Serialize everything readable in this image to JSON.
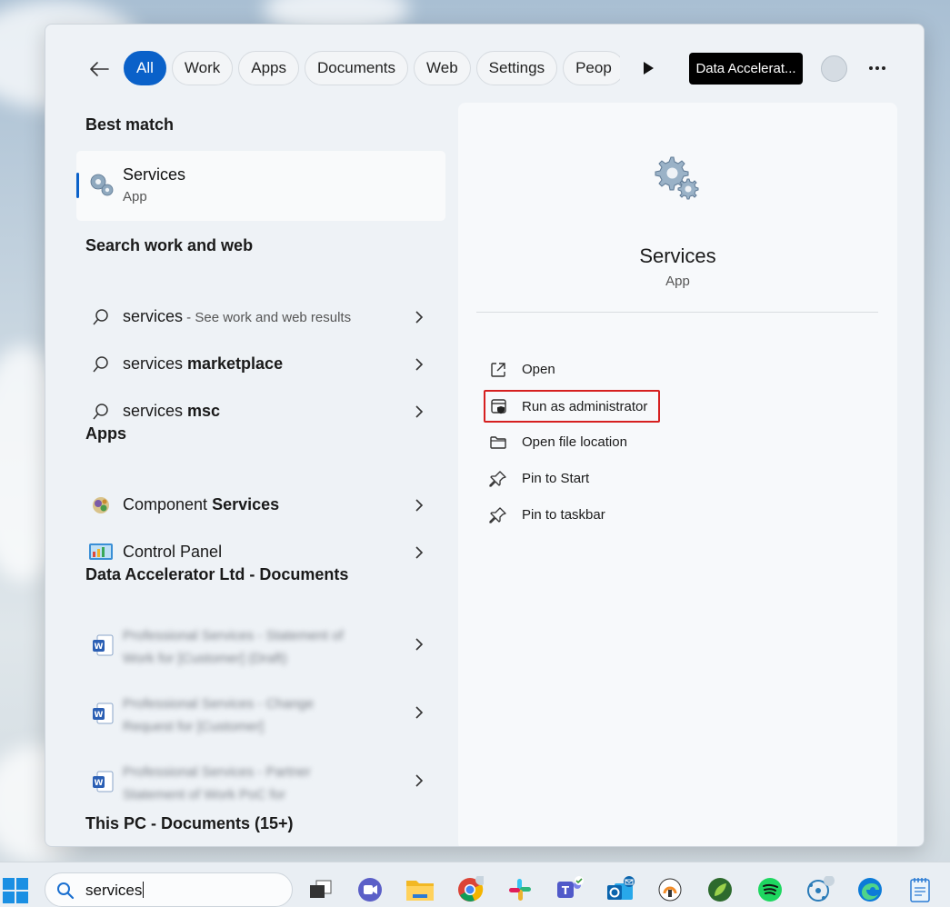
{
  "filters": {
    "chips": [
      "All",
      "Work",
      "Apps",
      "Documents",
      "Web",
      "Settings",
      "Peop"
    ],
    "active_index": 0,
    "org_label": "Data Accelerat..."
  },
  "best_match": {
    "heading": "Best match",
    "title": "Services",
    "subtitle": "App"
  },
  "web_section": {
    "heading": "Search work and web",
    "items": [
      {
        "query": "services",
        "bold": "",
        "hint": " - See work and web results"
      },
      {
        "query": "services ",
        "bold": "marketplace",
        "hint": ""
      },
      {
        "query": "services ",
        "bold": "msc",
        "hint": ""
      }
    ]
  },
  "apps_section": {
    "heading": "Apps",
    "items": [
      {
        "pre": "Component ",
        "bold": "Services",
        "icon": "component-services-icon"
      },
      {
        "pre": "Control Panel",
        "bold": "",
        "icon": "control-panel-icon"
      }
    ]
  },
  "docs_section": {
    "heading": "Data Accelerator Ltd - Documents",
    "items": [
      {
        "text": "Professional Services - Statement of Work for [Customer] (Draft)"
      },
      {
        "text": "Professional Services - Change Request for [Customer]"
      },
      {
        "text": "Professional Services - Partner Statement of Work PoC for"
      }
    ]
  },
  "pc_section": {
    "heading": "This PC - Documents (15+)"
  },
  "preview": {
    "title": "Services",
    "subtitle": "App",
    "actions": [
      "Open",
      "Run as administrator",
      "Open file location",
      "Pin to Start",
      "Pin to taskbar"
    ]
  },
  "taskbar": {
    "search_value": "services",
    "apps": [
      "task-view",
      "zoom",
      "file-explorer",
      "chrome",
      "slack",
      "teams",
      "outlook",
      "vpn",
      "greenshot",
      "spotify",
      "network-app",
      "edge",
      "notepad"
    ]
  },
  "colors": {
    "accent": "#0a61c9",
    "highlight_border": "#d62020"
  }
}
